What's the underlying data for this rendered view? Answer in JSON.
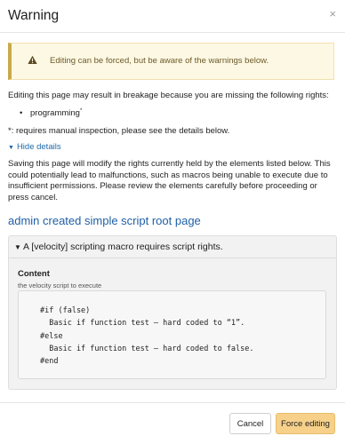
{
  "modal": {
    "title": "Warning",
    "close_symbol": "×"
  },
  "alert": {
    "icon": "warning-triangle-icon",
    "text": "Editing can be forced, but be aware of the warnings below."
  },
  "rights_intro": "Editing this page may result in breakage because you are missing the following rights:",
  "missing_rights": [
    {
      "name": "programming",
      "marker": "*"
    }
  ],
  "note": "*: requires manual inspection, please see the details below.",
  "details_toggle": {
    "label": "Hide details",
    "expanded": true
  },
  "details_text": "Saving this page will modify the rights currently held by the elements listed below. This could potentially lead to malfunctions, such as macros being unable to execute due to insufficient permissions. Please review the elements carefully before proceeding or press cancel.",
  "element_link": "admin created simple script root page",
  "macro_panel": {
    "title": "A [velocity] scripting macro requires script rights.",
    "expanded": true,
    "parameter_name": "Content",
    "parameter_description": "the velocity script to execute",
    "code": "#if (false)\n  Basic if function test – hard coded to “1”.\n#else\n  Basic if function test – hard coded to false.\n#end"
  },
  "footer": {
    "cancel_label": "Cancel",
    "force_label": "Force editing"
  },
  "colors": {
    "alert_bg": "#fcf8e3",
    "link": "#1f5fa6",
    "primary_button": "#f7d18a"
  }
}
